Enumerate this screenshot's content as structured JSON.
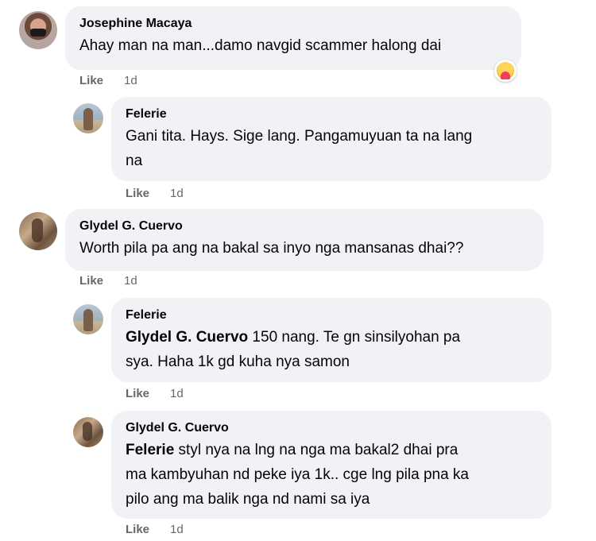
{
  "comments": [
    {
      "author": "Josephine Macaya",
      "text": "Ahay man na man...damo navgid scammer halong dai",
      "like": "Like",
      "time": "1d",
      "reaction": "care-reaction"
    },
    {
      "author": "Felerie",
      "text_line1": "Gani tita. Hays. Sige lang. Pangamuyuan ta na lang",
      "text_line2": "na",
      "like": "Like",
      "time": "1d"
    },
    {
      "author": "Glydel G. Cuervo",
      "text": "Worth pila pa ang na bakal sa inyo nga mansanas dhai??",
      "like": "Like",
      "time": "1d"
    },
    {
      "author": "Felerie",
      "mention": "Glydel G. Cuervo",
      "text_line1": " 150 nang. Te gn sinsilyohan pa",
      "text_line2": "sya. Haha 1k gd kuha nya samon",
      "like": "Like",
      "time": "1d"
    },
    {
      "author": "Glydel G. Cuervo",
      "mention": "Felerie",
      "text_line1": " styl nya na lng na nga ma bakal2 dhai pra",
      "text_line2": "ma kambyuhan nd peke iya 1k.. cge lng pila pna ka",
      "text_line3": "pilo ang ma balik nga nd nami sa iya",
      "like": "Like",
      "time": "1d"
    }
  ]
}
